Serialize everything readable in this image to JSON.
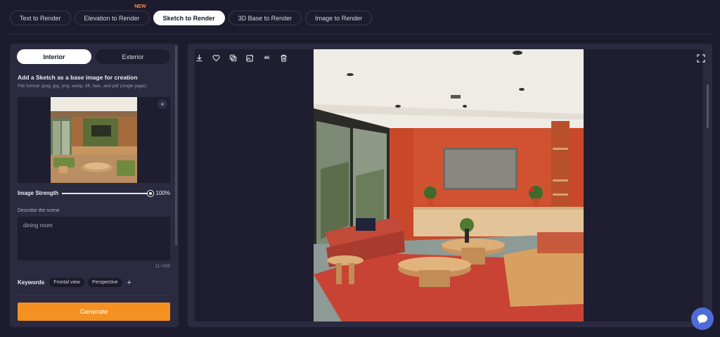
{
  "tabs": [
    {
      "label": "Text to Render"
    },
    {
      "label": "Elevation to Render",
      "badge": "NEW"
    },
    {
      "label": "Sketch to Render",
      "active": true
    },
    {
      "label": "3D Base to Render"
    },
    {
      "label": "Image to Render"
    }
  ],
  "panel": {
    "segments": {
      "interior": "Interior",
      "exterior": "Exterior",
      "selected": "Interior"
    },
    "upload_title": "Add a Sketch as a base image for creation",
    "upload_formats": "File format: jpeg, jpg, png, webp, tiff, heic, and pdf (single page).",
    "close_icon": "×",
    "strength": {
      "label": "Image Strength",
      "value_text": "100%",
      "value": 1.0
    },
    "describe": {
      "label": "Describe the scene",
      "value": "dining room",
      "counter": "11 / 600"
    },
    "keywords": {
      "label": "Keywords",
      "chips": [
        "Frontal view",
        "Perspective"
      ],
      "add": "+"
    },
    "generate_label": "Generate"
  },
  "toolbar": {
    "icons": [
      "download-icon",
      "heart-icon",
      "copy-icon",
      "image-edit-icon",
      "4k-icon",
      "trash-icon",
      "fullscreen-icon"
    ],
    "k4_label": "4K"
  },
  "colors": {
    "background": "#1c1c2e",
    "panel": "#2a2a40",
    "accent": "#f49122",
    "badge": "#ff8a3c",
    "chat": "#4e6bd6"
  }
}
